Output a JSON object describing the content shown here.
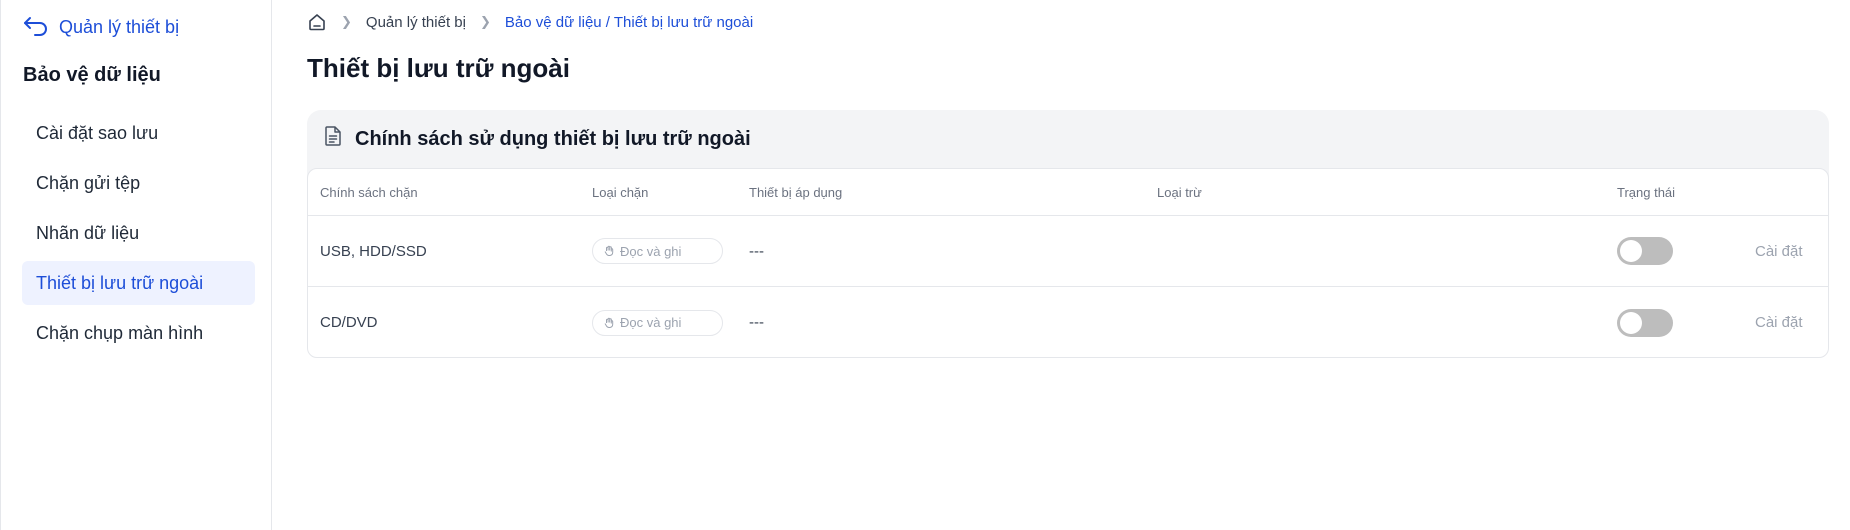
{
  "sidebar": {
    "back_label": "Quản lý thiết bị",
    "section_title": "Bảo vệ dữ liệu",
    "items": [
      {
        "label": "Cài đặt sao lưu",
        "active": false
      },
      {
        "label": "Chặn gửi tệp",
        "active": false
      },
      {
        "label": "Nhãn dữ liệu",
        "active": false
      },
      {
        "label": "Thiết bị lưu trữ ngoài",
        "active": true
      },
      {
        "label": "Chặn chụp màn hình",
        "active": false
      }
    ]
  },
  "breadcrumb": {
    "home_icon": "home-icon",
    "items": [
      "Quản lý thiết bị",
      "Bảo vệ dữ liệu / Thiết bị lưu trữ ngoài"
    ]
  },
  "page": {
    "title": "Thiết bị lưu trữ ngoài"
  },
  "policy_card": {
    "title": "Chính sách sử dụng thiết bị lưu trữ ngoài",
    "icon": "document-icon",
    "columns": [
      "Chính sách chặn",
      "Loại chặn",
      "Thiết bị áp dụng",
      "Loại trừ",
      "Trạng thái"
    ],
    "rows": [
      {
        "policy": "USB, HDD/SSD",
        "block_type": "Đọc và ghi",
        "devices": "---",
        "exclusions": "",
        "status_on": false,
        "action": "Cài đặt"
      },
      {
        "policy": "CD/DVD",
        "block_type": "Đọc và ghi",
        "devices": "---",
        "exclusions": "",
        "status_on": false,
        "action": "Cài đặt"
      }
    ]
  },
  "colors": {
    "accent": "#1d4ed8",
    "active_bg": "#eef2ff",
    "toggle_off": "#bdbdbd"
  }
}
